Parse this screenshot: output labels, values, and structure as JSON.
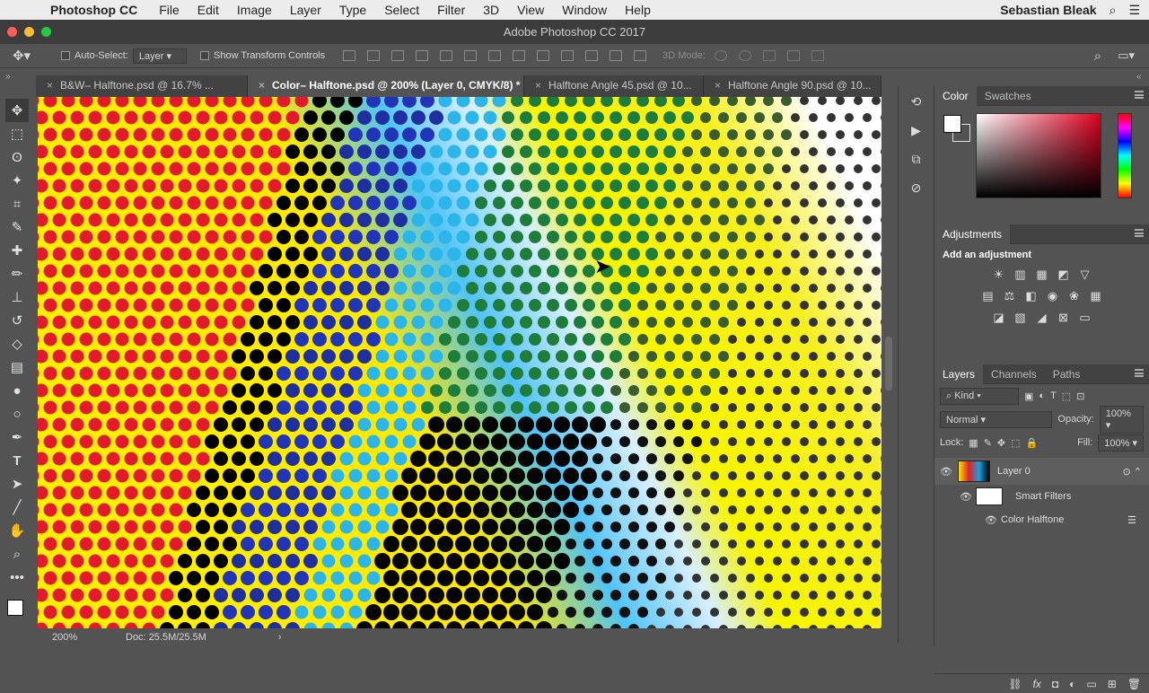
{
  "menubar": {
    "app_name": "Photoshop CC",
    "items": [
      "File",
      "Edit",
      "Image",
      "Layer",
      "Type",
      "Select",
      "Filter",
      "3D",
      "View",
      "Window",
      "Help"
    ],
    "user": "Sebastian Bleak"
  },
  "window": {
    "title": "Adobe Photoshop CC 2017"
  },
  "options_bar": {
    "auto_select_label": "Auto-Select:",
    "auto_select_value": "Layer",
    "show_transform_label": "Show Transform Controls",
    "mode_3d_label": "3D Mode:"
  },
  "tabs": [
    {
      "label": "B&W– Halftone.psd @ 16.7% ...",
      "active": false
    },
    {
      "label": "Color– Halftone.psd @ 200% (Layer 0, CMYK/8) *",
      "active": true
    },
    {
      "label": "Halftone Angle 45.psd @ 10...",
      "active": false
    },
    {
      "label": "Halftone Angle 90.psd @ 10...",
      "active": false
    }
  ],
  "status": {
    "zoom": "200%",
    "doc": "Doc: 25.5M/25.5M"
  },
  "color_panel": {
    "tabs": [
      "Color",
      "Swatches"
    ],
    "fg_color": "#ffffff",
    "bg_color": "#535353"
  },
  "adjustments_panel": {
    "tab": "Adjustments",
    "title": "Add an adjustment"
  },
  "layers_panel": {
    "tabs": [
      "Layers",
      "Channels",
      "Paths"
    ],
    "filter_kind": "Kind",
    "blend_mode": "Normal",
    "opacity_label": "Opacity:",
    "opacity_value": "100%",
    "lock_label": "Lock:",
    "fill_label": "Fill:",
    "fill_value": "100%",
    "layers": [
      {
        "name": "Layer 0"
      },
      {
        "name": "Smart Filters"
      },
      {
        "name": "Color Halftone"
      }
    ]
  }
}
